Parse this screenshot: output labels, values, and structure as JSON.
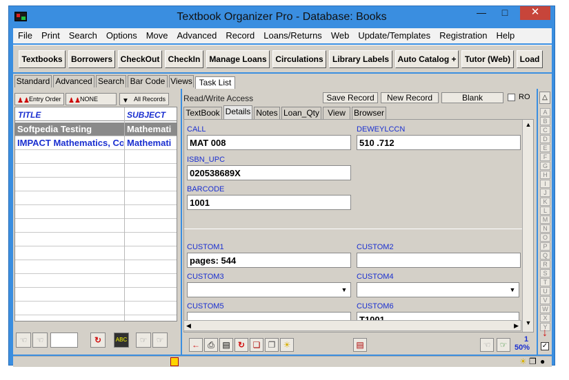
{
  "window": {
    "title": "Textbook Organizer Pro - Database: Books"
  },
  "menu": [
    "File",
    "Print",
    "Search",
    "Options",
    "Move",
    "Advanced",
    "Record",
    "Loans/Returns",
    "Web",
    "Update/Templates",
    "Registration",
    "Help"
  ],
  "toolbar": [
    "Textbooks",
    "Borrowers",
    "CheckOut",
    "CheckIn",
    "Manage Loans",
    "Circulations",
    "Library Labels",
    "Auto Catalog +",
    "Tutor (Web)",
    "Load"
  ],
  "subtabs": [
    "Standard",
    "Advanced",
    "Search",
    "Bar Code",
    "Views",
    "Task List"
  ],
  "sortbar": {
    "order": "Entry Order",
    "filter": "NONE",
    "records": "All Records"
  },
  "grid": {
    "columns": [
      "TITLE",
      "SUBJECT"
    ],
    "rows": [
      {
        "title": "Softpedia Testing",
        "subject": "Mathemati"
      },
      {
        "title": "IMPACT Mathematics, Co",
        "subject": "Mathemati"
      }
    ]
  },
  "access": {
    "label": "Read/Write Access",
    "save": "Save Record",
    "new": "New Record",
    "blank": "Blank",
    "ro": "RO"
  },
  "record_tabs": [
    "TextBook",
    "Details",
    "Notes",
    "Loan_Qty",
    "View",
    "Browser"
  ],
  "fields": {
    "call": {
      "label": "CALL",
      "value": "MAT 008"
    },
    "dewey": {
      "label": "DEWEYLCCN",
      "value": "510 .712"
    },
    "isbn": {
      "label": "ISBN_UPC",
      "value": "020538689X"
    },
    "barcode": {
      "label": "BARCODE",
      "value": "1001"
    },
    "custom1": {
      "label": "CUSTOM1",
      "value": "pages: 544"
    },
    "custom2": {
      "label": "CUSTOM2",
      "value": ""
    },
    "custom3": {
      "label": "CUSTOM3",
      "value": ""
    },
    "custom4": {
      "label": "CUSTOM4",
      "value": ""
    },
    "custom5": {
      "label": "CUSTOM5",
      "value": ""
    },
    "custom6": {
      "label": "CUSTOM6",
      "value": "T1001"
    }
  },
  "alphabet": [
    "A",
    "B",
    "C",
    "D",
    "E",
    "F",
    "G",
    "H",
    "I",
    "J",
    "K",
    "L",
    "M",
    "N",
    "O",
    "P",
    "Q",
    "R",
    "S",
    "T",
    "U",
    "V",
    "W",
    "X",
    "Y"
  ],
  "status": {
    "record_index": "1",
    "zoom": "50%"
  },
  "colors": {
    "title_bar": "#3a8ee0",
    "label_blue": "#1a2fd0",
    "selected_row": "#8a8a8a",
    "close": "#c7453a"
  }
}
